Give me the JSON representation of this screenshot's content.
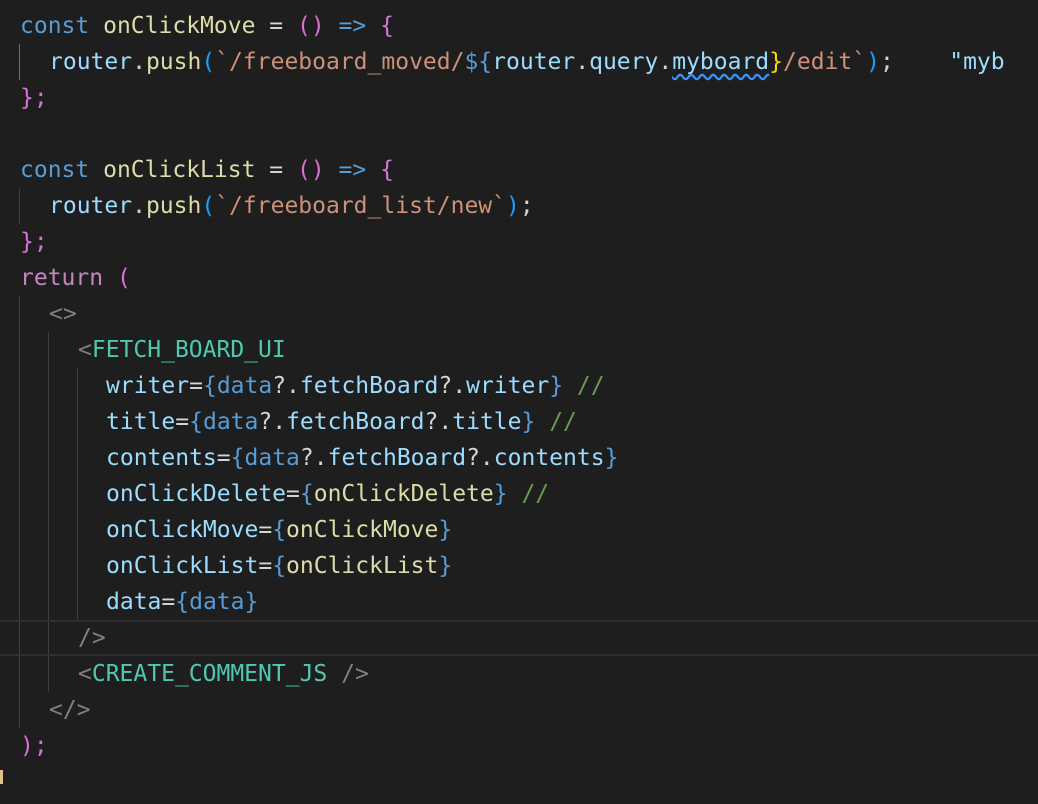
{
  "colors": {
    "background": "#1e1e1e",
    "keyword": "#569cd6",
    "control": "#c586c0",
    "function": "#dcdcaa",
    "variable": "#9cdcfe",
    "string": "#ce9178",
    "component": "#4ec9b0",
    "comment": "#6a9955"
  },
  "code": {
    "l1": {
      "kw": "const",
      "name": "onClickMove",
      "eq": " = ",
      "paren": "()",
      "arrow": " => ",
      "brace": "{"
    },
    "l2": {
      "obj": "router",
      "dot": ".",
      "method": "push",
      "po": "(",
      "str1": "`/freeboard_moved/",
      "dollar": "${",
      "obj2": "router",
      "dot2": ".",
      "prop1": "query",
      "dot3": ".",
      "prop2": "myboard",
      "close": "}",
      "str2": "/edit`",
      "pc": ")",
      "semi": ";",
      "trail": "\"myb"
    },
    "l3": {
      "text": "};"
    },
    "l5": {
      "kw": "const",
      "name": "onClickList",
      "eq": " = ",
      "paren": "()",
      "arrow": " => ",
      "brace": "{"
    },
    "l6": {
      "obj": "router",
      "dot": ".",
      "method": "push",
      "po": "(",
      "str": "`/freeboard_list/new`",
      "pc": ")",
      "semi": ";"
    },
    "l7": {
      "text": "};"
    },
    "l8": {
      "kw": "return",
      "paren": " ("
    },
    "l9": {
      "text": "<>"
    },
    "l10": {
      "lt": "<",
      "tag": "FETCH_BOARD_UI"
    },
    "l11": {
      "attr": "writer",
      "eq": "=",
      "bo": "{",
      "v1": "data",
      "opt": "?.",
      "v2": "fetchBoard",
      "opt2": "?.",
      "v3": "writer",
      "bc": "}",
      "cmt": " //"
    },
    "l12": {
      "attr": "title",
      "eq": "=",
      "bo": "{",
      "v1": "data",
      "opt": "?.",
      "v2": "fetchBoard",
      "opt2": "?.",
      "v3": "title",
      "bc": "}",
      "cmt": " //"
    },
    "l13": {
      "attr": "contents",
      "eq": "=",
      "bo": "{",
      "v1": "data",
      "opt": "?.",
      "v2": "fetchBoard",
      "opt2": "?.",
      "v3": "contents",
      "bc": "}"
    },
    "l14": {
      "attr": "onClickDelete",
      "eq": "=",
      "bo": "{",
      "v": "onClickDelete",
      "bc": "}",
      "cmt": " //"
    },
    "l15": {
      "attr": "onClickMove",
      "eq": "=",
      "bo": "{",
      "v": "onClickMove",
      "bc": "}"
    },
    "l16": {
      "attr": "onClickList",
      "eq": "=",
      "bo": "{",
      "v": "onClickList",
      "bc": "}"
    },
    "l17": {
      "attr": "data",
      "eq": "=",
      "bo": "{",
      "v": "data",
      "bc": "}"
    },
    "l18": {
      "text": "/>"
    },
    "l19": {
      "lt": "<",
      "tag": "CREATE_COMMENT_JS",
      "end": " />"
    },
    "l20": {
      "text": "</>"
    },
    "l21": {
      "text": ");"
    }
  }
}
